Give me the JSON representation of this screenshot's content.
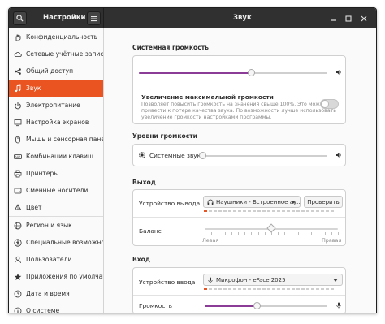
{
  "header": {
    "app_title": "Настройки",
    "page_title": "Звук",
    "search_icon": "search-icon",
    "menu_icon": "hamburger-icon"
  },
  "sidebar": {
    "items": [
      {
        "label": "Конфиденциальность",
        "icon": "hand-icon",
        "chevron": "›"
      },
      {
        "label": "Сетевые учётные записи",
        "icon": "cloud-icon"
      },
      {
        "label": "Общий доступ",
        "icon": "share-icon"
      },
      {
        "label": "Звук",
        "icon": "music-note-icon",
        "active": true
      },
      {
        "label": "Электропитание",
        "icon": "power-icon"
      },
      {
        "label": "Настройка экранов",
        "icon": "display-icon"
      },
      {
        "label": "Мышь и сенсорная панель",
        "icon": "mouse-icon"
      },
      {
        "label": "Комбинации клавиш",
        "icon": "keyboard-icon"
      },
      {
        "label": "Принтеры",
        "icon": "printer-icon"
      },
      {
        "label": "Сменные носители",
        "icon": "media-icon"
      },
      {
        "label": "Цвет",
        "icon": "color-icon"
      },
      {
        "label": "Регион и язык",
        "icon": "globe-icon"
      },
      {
        "label": "Специальные возможности",
        "icon": "accessibility-icon"
      },
      {
        "label": "Пользователи",
        "icon": "users-icon"
      },
      {
        "label": "Приложения по умолчанию",
        "icon": "star-icon"
      },
      {
        "label": "Дата и время",
        "icon": "clock-icon"
      },
      {
        "label": "О системе",
        "icon": "info-icon"
      }
    ]
  },
  "system_volume": {
    "title": "Системная громкость",
    "level": 0.6,
    "boost_label": "Увеличение максимальной громкости",
    "boost_desc_1": "Позволяет повысить громкость на значения свыше 100%. Это может",
    "boost_desc_2": "привести к потере качества звука. По возможности лучше использовать",
    "boost_desc_3": "увеличение громкости настройками программы.",
    "boost_enabled": false
  },
  "volume_levels": {
    "title": "Уровни громкости",
    "system_sounds_label": "Системные звуки",
    "system_sounds_level": 0.0
  },
  "output": {
    "title": "Выход",
    "device_label": "Устройство вывода",
    "device_value": "Наушники - Встроенное ау...",
    "test_button": "Проверить",
    "balance_label": "Баланс",
    "balance_left": "Левая",
    "balance_right": "Правая",
    "balance_value": 0.5
  },
  "input": {
    "title": "Вход",
    "device_label": "Устройство ввода",
    "device_value": "Микрофон - eFace 2025",
    "volume_label": "Громкость",
    "volume_level": 0.43
  },
  "colors": {
    "accent": "#e95420",
    "slider_fill": "#8a3c97",
    "header_bg": "#303030"
  }
}
